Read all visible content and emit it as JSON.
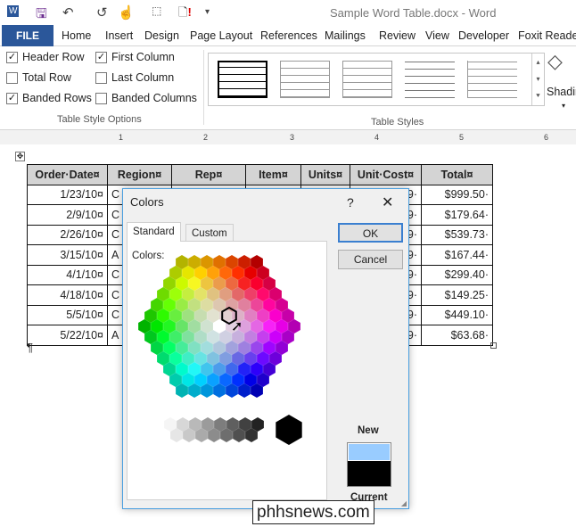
{
  "window": {
    "title": "Sample Word Table.docx - Word"
  },
  "quick_access": [
    "word-logo-icon",
    "save-icon",
    "undo-icon",
    "redo-icon",
    "touch-mode-icon",
    "select-icon",
    "new-document-icon",
    "customize-icon"
  ],
  "tabs": {
    "file": "FILE",
    "items": [
      "Home",
      "Insert",
      "Design",
      "Page Layout",
      "References",
      "Mailings",
      "Review",
      "View",
      "Developer",
      "Foxit Reader"
    ]
  },
  "ribbon": {
    "options": [
      {
        "label": "Header Row",
        "checked": true
      },
      {
        "label": "Total Row",
        "checked": false
      },
      {
        "label": "Banded Rows",
        "checked": true
      },
      {
        "label": "First Column",
        "checked": true
      },
      {
        "label": "Last Column",
        "checked": false
      },
      {
        "label": "Banded Columns",
        "checked": false
      }
    ],
    "options_group": "Table Style Options",
    "styles_group": "Table Styles",
    "shading": "Shading"
  },
  "ruler": [
    "1",
    "2",
    "3",
    "4",
    "5",
    "6"
  ],
  "table": {
    "headers": [
      "Order·Date¤",
      "Region¤",
      "Rep¤",
      "Item¤",
      "Units¤",
      "Unit·Cost¤",
      "Total¤"
    ],
    "rows": [
      [
        "1/23/10¤",
        "C",
        "",
        "",
        "",
        "9·",
        "$999.50·"
      ],
      [
        "2/9/10¤",
        "C",
        "",
        "",
        "",
        "9·",
        "$179.64·"
      ],
      [
        "2/26/10¤",
        "C",
        "",
        "",
        "",
        "9·",
        "$539.73·"
      ],
      [
        "3/15/10¤",
        "A",
        "",
        "",
        "",
        "9·",
        "$167.44·"
      ],
      [
        "4/1/10¤",
        "C",
        "",
        "",
        "",
        "9·",
        "$299.40·"
      ],
      [
        "4/18/10¤",
        "C",
        "",
        "",
        "",
        "9·",
        "$149.25·"
      ],
      [
        "5/5/10¤",
        "C",
        "",
        "",
        "",
        "9·",
        "$449.10·"
      ],
      [
        "5/22/10¤",
        "A",
        "",
        "",
        "",
        "9·",
        "$63.68·"
      ]
    ],
    "row_mark": "¤",
    "pilcrow": "¶"
  },
  "dialog": {
    "title": "Colors",
    "help": "?",
    "close": "✕",
    "tabs": [
      "Standard",
      "Custom"
    ],
    "colors_label": "Colors:",
    "ok": "OK",
    "cancel": "Cancel",
    "new_label": "New",
    "current_label": "Current",
    "new_color": "#99ccff",
    "current_color": "#000000"
  },
  "watermark": "phhsnews.com"
}
